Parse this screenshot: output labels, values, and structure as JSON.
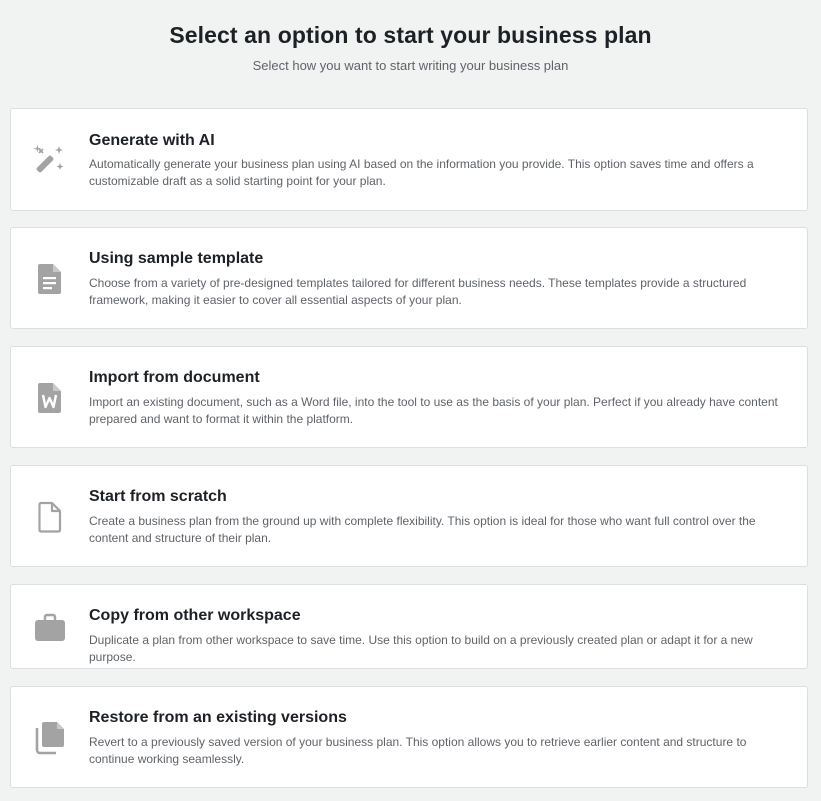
{
  "header": {
    "title": "Select an option to start your business plan",
    "subtitle": "Select how you want to start writing your business plan"
  },
  "options": [
    {
      "icon": "magic-wand-icon",
      "title": "Generate with AI",
      "description": "Automatically generate your business plan using AI based on the information you provide. This option saves time and offers a customizable draft as a solid starting point for your plan."
    },
    {
      "icon": "document-icon",
      "title": "Using sample template",
      "description": "Choose from a variety of pre-designed templates tailored for different business needs. These templates provide a structured framework, making it easier to cover all essential aspects of your plan."
    },
    {
      "icon": "word-document-icon",
      "title": "Import from document",
      "description": "Import an existing document, such as a Word file, into the tool to use as the basis of your plan. Perfect if you already have content prepared and want to format it within the platform."
    },
    {
      "icon": "blank-file-icon",
      "title": "Start from scratch",
      "description": "Create a business plan from the ground up with complete flexibility. This option is ideal for those who want full control over the content and structure of their plan."
    },
    {
      "icon": "briefcase-icon",
      "title": "Copy from other workspace",
      "description": "Duplicate a plan from other workspace to save time. Use this option to build on a previously created plan or adapt it for a new purpose."
    },
    {
      "icon": "copy-files-icon",
      "title": "Restore from an existing versions",
      "description": "Revert to a previously saved version of your business plan. This option allows you to retrieve earlier content and structure to continue working seamlessly."
    }
  ],
  "colors": {
    "background": "#f1f2f2",
    "card": "#ffffff",
    "icon": "#a3a3a3"
  }
}
